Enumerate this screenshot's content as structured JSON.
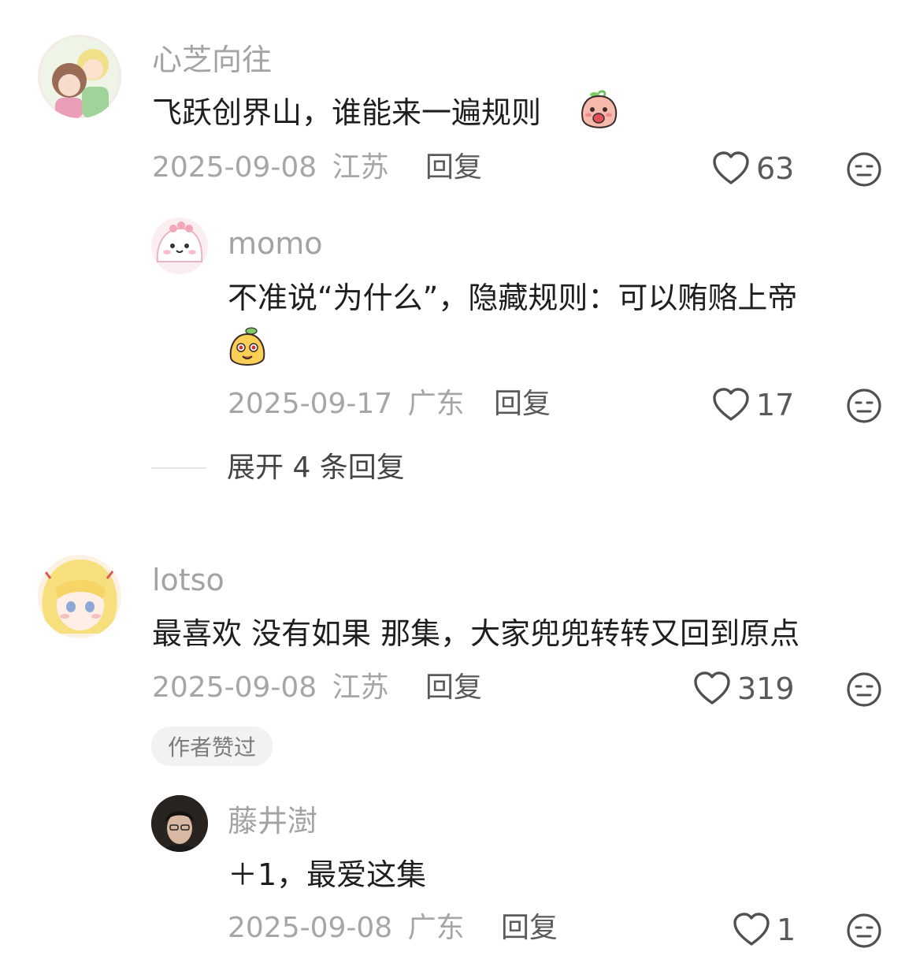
{
  "comments": [
    {
      "username": "心芝向往",
      "text": "飞跃创界山，谁能来一遍规则",
      "emoji": "peach-emoji",
      "date": "2025-09-08",
      "location": "江苏",
      "reply_label": "回复",
      "likes": "63",
      "replies": [
        {
          "username": "momo",
          "text": "不准说“为什么”，隐藏规则：可以贿赂上帝",
          "emoji": "mango-emoji",
          "date": "2025-09-17",
          "location": "广东",
          "reply_label": "回复",
          "likes": "17"
        }
      ],
      "expand_label": "展开 4 条回复"
    },
    {
      "username": "lotso",
      "text": "最喜欢 没有如果 那集，大家兜兜转转又回到原点",
      "date": "2025-09-08",
      "location": "江苏",
      "reply_label": "回复",
      "likes": "319",
      "badge": "作者赞过",
      "replies": [
        {
          "username": "藤井澍",
          "text": "＋1，最爱这集",
          "date": "2025-09-08",
          "location": "广东",
          "reply_label": "回复",
          "likes": "1"
        }
      ]
    }
  ],
  "colors": {
    "username": "#a3a3a3",
    "text": "#1e1e1e",
    "meta": "#a6a6a6",
    "reply": "#5a5a5a"
  },
  "icons": {
    "like": "heart-outline-icon",
    "dislike": "neutral-face-icon"
  }
}
